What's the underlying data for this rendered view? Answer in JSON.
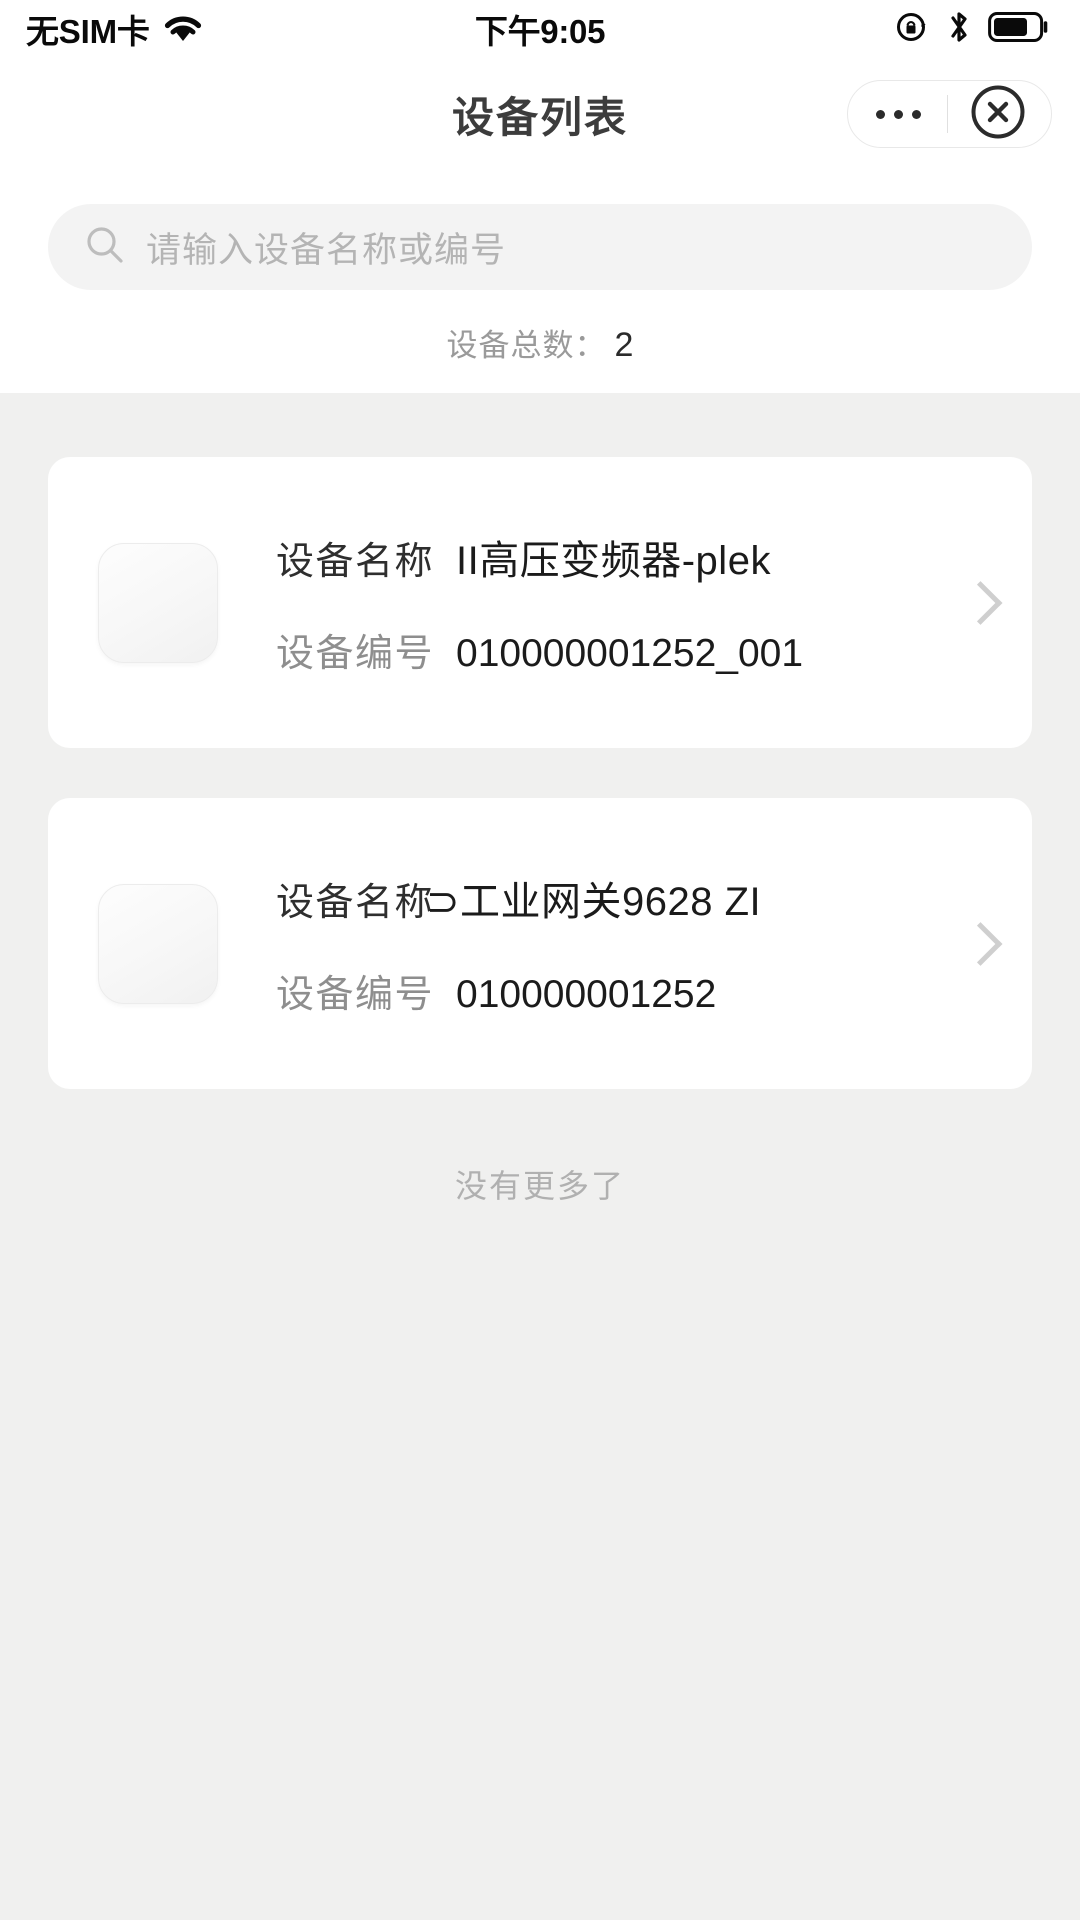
{
  "status_bar": {
    "carrier": "无SIM卡",
    "time": "下午9:05",
    "icons": [
      "wifi-icon",
      "rotation-lock-icon",
      "bluetooth-icon",
      "battery-icon"
    ],
    "battery_level_pct": 75
  },
  "nav": {
    "title": "设备列表",
    "capsule": {
      "more_label": "···",
      "close_label": "✕"
    }
  },
  "search": {
    "placeholder": "请输入设备名称或编号",
    "value": "",
    "icon": "search-icon"
  },
  "summary": {
    "total_label": "设备总数：",
    "total_value": "2"
  },
  "list": {
    "name_label": "设备名称",
    "code_label": "设备编号",
    "items": [
      {
        "name": "II高压变频器-plek",
        "code": "010000001252_001"
      },
      {
        "name": "⊃工业网关9628  ZI",
        "code": "010000001252"
      }
    ],
    "footer": "没有更多了"
  },
  "colors": {
    "page_bg": "#f0f0ef",
    "card_bg": "#ffffff",
    "search_bg": "#f3f3f3",
    "label_gray": "#8e8e8e",
    "value_dark": "#1b1b1b",
    "chevron_gray": "#cfcfcf",
    "footer_gray": "#b0b0b0"
  }
}
